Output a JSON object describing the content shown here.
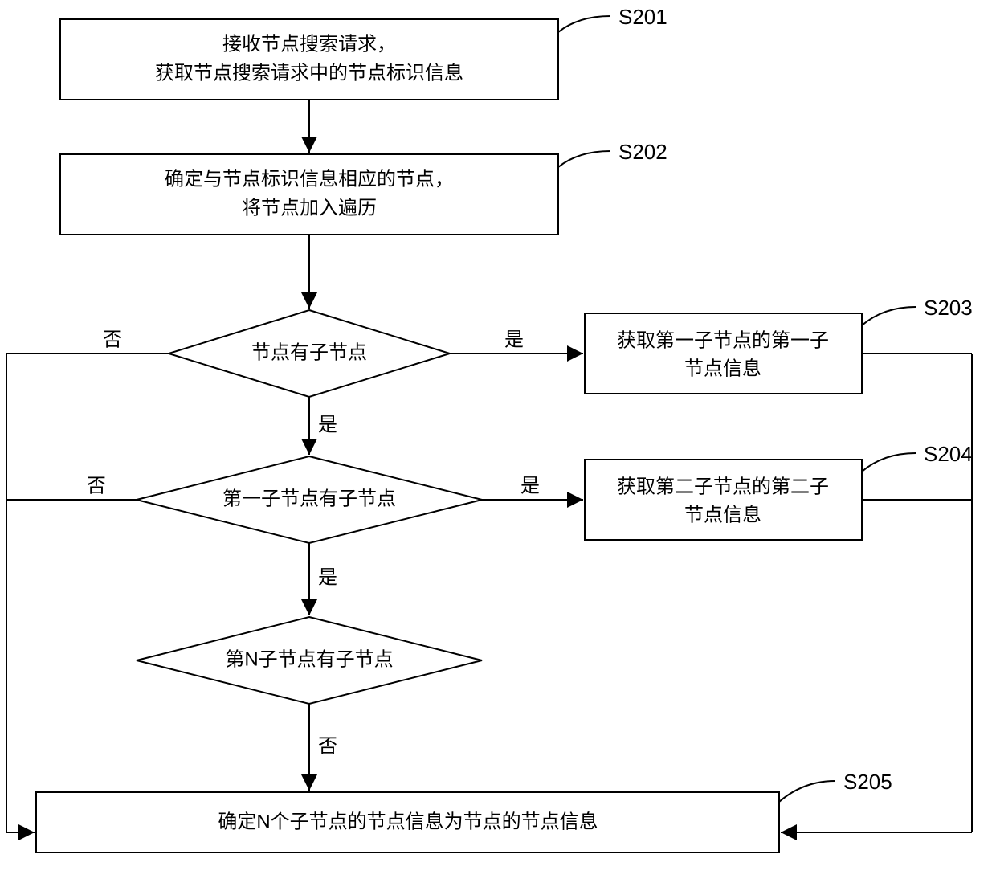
{
  "steps": {
    "s201": {
      "label": "S201",
      "line1": "接收节点搜索请求，",
      "line2": "获取节点搜索请求中的节点标识信息"
    },
    "s202": {
      "label": "S202",
      "line1": "确定与节点标识信息相应的节点，",
      "line2": "将节点加入遍历"
    },
    "s203": {
      "label": "S203",
      "line1": "获取第一子节点的第一子",
      "line2": "节点信息"
    },
    "s204": {
      "label": "S204",
      "line1": "获取第二子节点的第二子",
      "line2": "节点信息"
    },
    "s205": {
      "label": "S205",
      "text": "确定N个子节点的节点信息为节点的节点信息"
    }
  },
  "decisions": {
    "d1": "节点有子节点",
    "d2": "第一子节点有子节点",
    "d3": "第N子节点有子节点"
  },
  "labels": {
    "yes": "是",
    "no": "否"
  }
}
